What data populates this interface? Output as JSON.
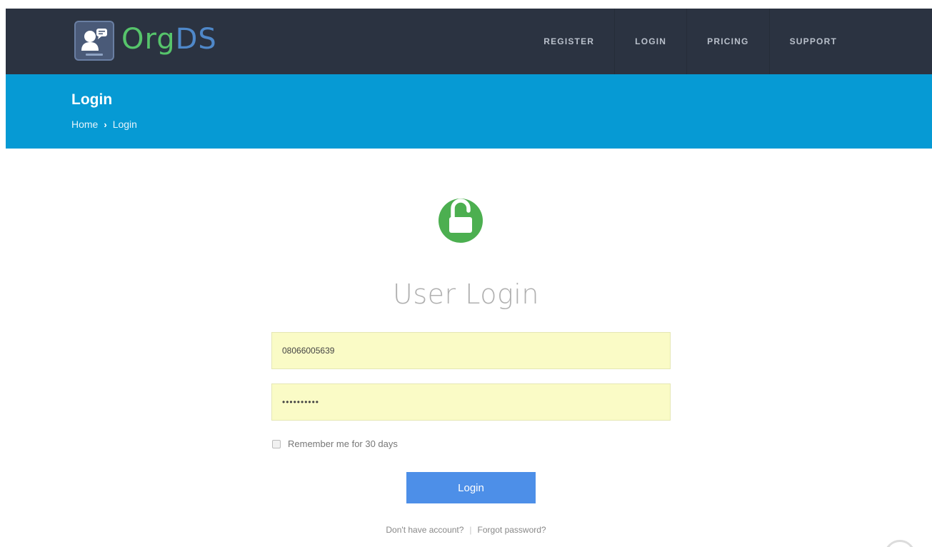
{
  "header": {
    "logo": {
      "text_org": "Org",
      "text_ds": "DS",
      "badge_icon": "user-chat-icon"
    },
    "nav": [
      "REGISTER",
      "LOGIN",
      "PRICING",
      "SUPPORT"
    ]
  },
  "titlebar": {
    "title": "Login",
    "breadcrumb": {
      "home": "Home",
      "separator": "›",
      "current": "Login"
    }
  },
  "main": {
    "lock_icon": "unlock-icon",
    "heading": "User Login",
    "phone_value": "08066005639",
    "password_value": "••••••••••",
    "remember_label": "Remember me for 30 days",
    "login_button": "Login",
    "no_account_link": "Don't have account?",
    "divider": "|",
    "forgot_link": "Forgot password?"
  },
  "colors": {
    "header_bg": "#2b3341",
    "titlebar_bg": "#069ad4",
    "lock_green": "#4caf50",
    "input_bg": "#fafbc6",
    "button_blue": "#4d8fe8"
  }
}
